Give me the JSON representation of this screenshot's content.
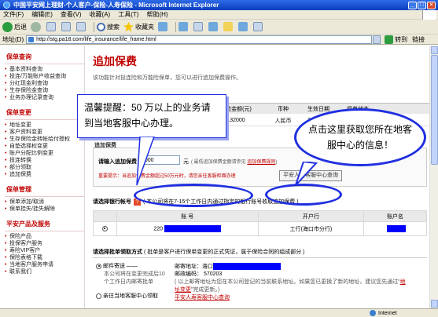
{
  "window": {
    "title": "中国平安网上理财-个人客户-保险-人寿保险 - Microsoft Internet Explorer",
    "controls": [
      "_",
      "□",
      "×"
    ]
  },
  "menu": [
    "文件(F)",
    "编辑(E)",
    "查看(V)",
    "收藏(A)",
    "工具(T)",
    "帮助(H)"
  ],
  "toolbar": {
    "back": "后退",
    "search": "搜索",
    "favorites": "收藏夹"
  },
  "address": {
    "label": "地址(D)",
    "url": "http://stg.pa18.com/life_insurance/life_frame.html",
    "go": "转到",
    "links": "链接"
  },
  "sidebar": {
    "groups": [
      {
        "title": "保单查询",
        "items": [
          "基本资料查询",
          "投连/万能账户收益查询",
          "分红现金利查询",
          "生存保险金查询",
          "业务办理记录查询"
        ]
      },
      {
        "title": "保单变更",
        "items": [
          "地址变更",
          "客户资料变更",
          "生存保险金转帐给付授权",
          "自垫选择权变更",
          "账户分配比例变更",
          "投连转换",
          "部分领取",
          "追加保费"
        ]
      },
      {
        "title": "保单管理",
        "items": [
          "保单添加/取消",
          "保单挂失/挂失解除"
        ]
      },
      {
        "title": "平安产品及服务",
        "items": [
          "保险产品",
          "投保客户服务",
          "寿险VIP客户",
          "保险表格下载",
          "当地客户服务申请",
          "联系我们"
        ]
      }
    ]
  },
  "main": {
    "title": "追加保费",
    "desc": "该功能针对投连险和万能险保单，您可以进行追加保费操作。",
    "policy_header": [
      "保险金额(元)",
      "币种",
      "生效日期",
      "保单状态"
    ],
    "policy_row": [
      "132000",
      "人民币",
      "2001-02-",
      ""
    ],
    "add_section_label": "追加保费",
    "add_label": "请输入追加保费",
    "add_value": "1000",
    "unit": "元",
    "hint_prefix": "( 最低追加保费金额请参见 ",
    "hint_link": "追加保费规则",
    "hint_suffix": ")",
    "warn": "重要提示：当追加保费金额超过50万元时，请您亲往客服柜面办理",
    "service_button": "平安人寿客服中心查询",
    "bank_label": "请选择银行帐号",
    "bank_note": "( 本公司将在7-15个工作日内通过指定的银行账号收取追加保费 )",
    "bank_headers": [
      "账 号",
      "开户行",
      "账户名"
    ],
    "bank_row": {
      "account_prefix": "220",
      "bank": "工行(海口市分行)"
    },
    "receive_label": "请选择批单领取方式",
    "receive_note": "( 批单是客户进行保单变更的正式凭证，属于保险合同的组成部分 )",
    "mail_option": "邮件寄送 ——",
    "mail_desc": "本公司将在变更完成后10个工作日内邮寄批单",
    "mail_addr_label": "邮寄地址：海口",
    "zip_label": "邮政编码： 570203",
    "addr_note": "( 以上邮寄地址为您在本公司登记的当前联系地址。如果您已更换了新的地址，建议您先通过“",
    "addr_note_link": "地址变更",
    "addr_note_end": "”完成更新。)",
    "service_option": "亲往当地客服中心领取",
    "service_link": "平安人寿客服中心查询"
  },
  "callouts": {
    "left_bubble": "温馨提醒：50 万以上的业务请到当地客服中心办理。",
    "right_bubble": "点击这里获取您所在地客服中心的信息！"
  },
  "status": {
    "zone": "Internet"
  },
  "colors": {
    "accent": "#c00000",
    "callout": "#1f2fe0",
    "redaction": "#0000ff"
  }
}
